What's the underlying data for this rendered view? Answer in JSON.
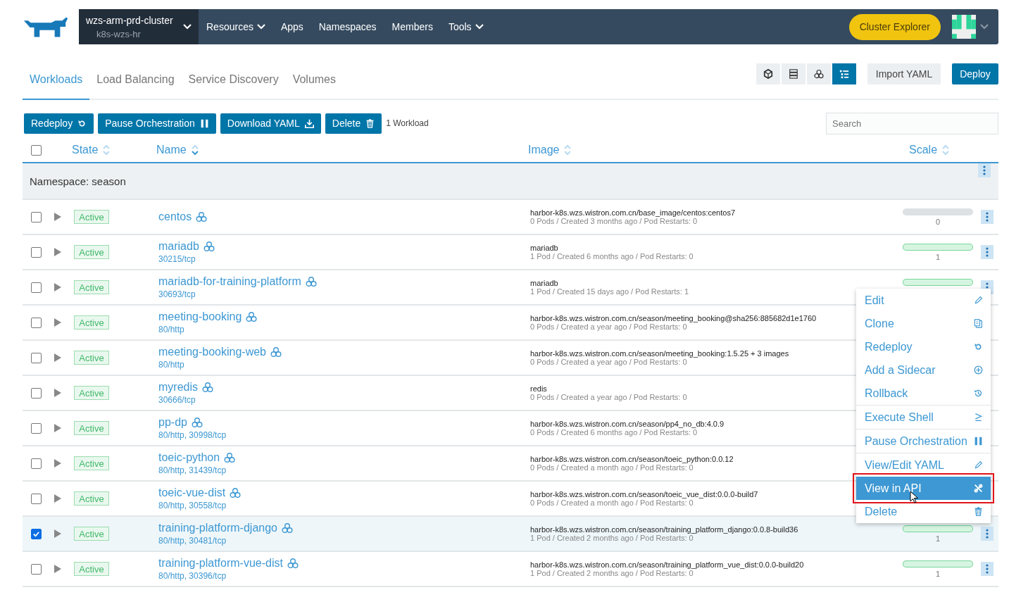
{
  "header": {
    "cluster": {
      "name": "wzs-arm-prd-cluster",
      "project": "k8s-wzs-hr"
    },
    "nav": [
      {
        "label": "Resources",
        "dropdown": true
      },
      {
        "label": "Apps",
        "dropdown": false
      },
      {
        "label": "Namespaces",
        "dropdown": false
      },
      {
        "label": "Members",
        "dropdown": false
      },
      {
        "label": "Tools",
        "dropdown": true
      }
    ],
    "cluster_explorer": "Cluster Explorer"
  },
  "tabs": [
    {
      "label": "Workloads",
      "selected": true
    },
    {
      "label": "Load Balancing",
      "selected": false
    },
    {
      "label": "Service Discovery",
      "selected": false
    },
    {
      "label": "Volumes",
      "selected": false
    }
  ],
  "view_modes": [
    {
      "kind": "node",
      "selected": false
    },
    {
      "kind": "list",
      "selected": false
    },
    {
      "kind": "group",
      "selected": false
    },
    {
      "kind": "tree",
      "selected": true
    }
  ],
  "page_actions": [
    {
      "label": "Import YAML",
      "kind": "secondary"
    },
    {
      "label": "Deploy",
      "kind": "primary"
    }
  ],
  "bulk_actions": [
    {
      "label": "Redeploy",
      "kind": "redeploy"
    },
    {
      "label": "Pause Orchestration",
      "kind": "pause"
    },
    {
      "label": "Download YAML",
      "kind": "download"
    },
    {
      "label": "Delete",
      "kind": "delete"
    }
  ],
  "selection_count": "1 Workload",
  "search": {
    "placeholder": "Search"
  },
  "table": {
    "select_all": {
      "checked": false
    },
    "columns": [
      {
        "label": "State",
        "sorted": false
      },
      {
        "label": "Name",
        "sorted": true
      },
      {
        "label": "Image",
        "sorted": false
      },
      {
        "label": "Scale",
        "sorted": false
      }
    ],
    "group": {
      "label": "Namespace: season"
    },
    "rows": [
      {
        "checked": false,
        "state": "Active",
        "name": "centos",
        "image": "harbor-k8s.wzs.wistron.com.cn/base_image/centos:centos7",
        "details": "0 Pods / Created 3 months ago / Pod Restarts: 0",
        "scale": {
          "ready": false,
          "count": "0"
        }
      },
      {
        "checked": false,
        "state": "Active",
        "name": "mariadb",
        "endpoints": "30215/tcp",
        "image": "mariadb",
        "details": "1 Pod / Created 6 months ago / Pod Restarts: 0",
        "scale": {
          "ready": true,
          "count": "1"
        }
      },
      {
        "checked": false,
        "state": "Active",
        "name": "mariadb-for-training-platform",
        "endpoints": "30693/tcp",
        "image": "mariadb",
        "details": "1 Pod / Created 15 days ago / Pod Restarts: 1",
        "scale": {
          "ready": true
        }
      },
      {
        "checked": false,
        "state": "Active",
        "name": "meeting-booking",
        "endpoints": "80/http",
        "image": "harbor-k8s.wzs.wistron.com.cn/season/meeting_booking@sha256:885682d1e1760",
        "details": "0 Pods / Created a year ago / Pod Restarts: 0"
      },
      {
        "checked": false,
        "state": "Active",
        "name": "meeting-booking-web",
        "endpoints": "80/http",
        "image": "harbor-k8s.wzs.wistron.com.cn/season/meeting_booking:1.5.25 + 3 images",
        "details": "0 Pods / Created a year ago / Pod Restarts: 0"
      },
      {
        "checked": false,
        "state": "Active",
        "name": "myredis",
        "endpoints": "30666/tcp",
        "image": "redis",
        "details": "0 Pods / Created a year ago / Pod Restarts: 0"
      },
      {
        "checked": false,
        "state": "Active",
        "name": "pp-dp",
        "endpoints": "80/http, 30998/tcp",
        "image": "harbor-k8s.wzs.wistron.com.cn/season/pp4_no_db:4.0.9",
        "details": "0 Pods / Created 6 months ago / Pod Restarts: 0"
      },
      {
        "checked": false,
        "state": "Active",
        "name": "toeic-python",
        "endpoints": "80/http, 31439/tcp",
        "image": "harbor-k8s.wzs.wistron.com.cn/season/toeic_python:0.0.12",
        "details": "0 Pods / Created a month ago / Pod Restarts: 0"
      },
      {
        "checked": false,
        "state": "Active",
        "name": "toeic-vue-dist",
        "endpoints": "80/http, 30558/tcp",
        "image": "harbor-k8s.wzs.wistron.com.cn/season/toeic_vue_dist:0.0.0-build7",
        "details": "0 Pods / Created a month ago / Pod Restarts: 0"
      },
      {
        "checked": true,
        "state": "Active",
        "name": "training-platform-django",
        "endpoints": "80/http, 30481/tcp",
        "image": "harbor-k8s.wzs.wistron.com.cn/season/training_platform_django:0.0.8-build36",
        "details": "1 Pod / Created 2 months ago / Pod Restarts: 0",
        "scale": {
          "ready": true,
          "count": "1"
        }
      },
      {
        "checked": false,
        "state": "Active",
        "name": "training-platform-vue-dist",
        "endpoints": "80/http, 30396/tcp",
        "image": "harbor-k8s.wzs.wistron.com.cn/season/training_platform_vue_dist:0.0.0-build20",
        "details": "1 Pod / Created 2 months ago / Pod Restarts: 0",
        "scale": {
          "ready": true,
          "count": "1"
        }
      }
    ]
  },
  "action_menu": {
    "items": [
      {
        "label": "Edit",
        "kind": "edit",
        "selected": false,
        "divider_after": false
      },
      {
        "label": "Clone",
        "kind": "clone",
        "selected": false,
        "divider_after": false
      },
      {
        "label": "Redeploy",
        "kind": "redeploy",
        "selected": false,
        "divider_after": false
      },
      {
        "label": "Add a Sidecar",
        "kind": "sidecar",
        "selected": false,
        "divider_after": false
      },
      {
        "label": "Rollback",
        "kind": "rollback",
        "selected": false,
        "divider_after": true
      },
      {
        "label": "Execute Shell",
        "kind": "shell",
        "selected": false,
        "divider_after": true
      },
      {
        "label": "Pause Orchestration",
        "kind": "pause",
        "selected": false,
        "divider_after": true
      },
      {
        "label": "View/Edit YAML",
        "kind": "edit",
        "selected": false,
        "divider_after": false
      },
      {
        "label": "View in API",
        "kind": "api",
        "selected": true,
        "divider_after": false
      },
      {
        "label": "Delete",
        "kind": "delete",
        "selected": false,
        "divider_after": false
      }
    ]
  }
}
